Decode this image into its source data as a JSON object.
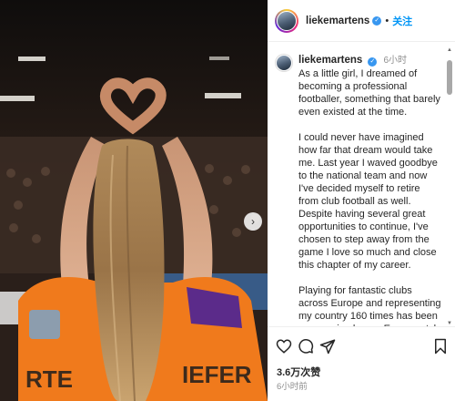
{
  "post": {
    "username": "liekemartens",
    "follow_label": "关注",
    "dot": "•",
    "verified_icon": "✓",
    "caption_time": "6小时",
    "caption_paragraphs": [
      "As a little girl, I dreamed of becoming a professional footballer, something that barely even existed at the time.",
      "I could never have imagined how far that dream would take me. Last year I waved goodbye to the national team and now I've decided myself to retire from club football as well. Despite having several great opportunities to continue, I've chosen to step away from the game I love so much and close this chapter of my career.",
      "Playing for fantastic clubs across Europe and representing my country 160 times has been an amazing honor. Every match, every moment"
    ],
    "likes": "3.6万次赞",
    "time_ago": "6小时前"
  },
  "photo": {
    "jersey_text_left": "RTE",
    "jersey_text_right": "IEFER",
    "jersey_color": "#f07a1c",
    "crowd_color": "#3a2b24"
  },
  "icons": {
    "next": "›",
    "like": "heart-icon",
    "comment": "comment-icon",
    "share": "share-icon",
    "save": "bookmark-icon"
  },
  "colors": {
    "accent": "#0095f6",
    "verified": "#3897f0",
    "muted": "#8e8e8e"
  }
}
